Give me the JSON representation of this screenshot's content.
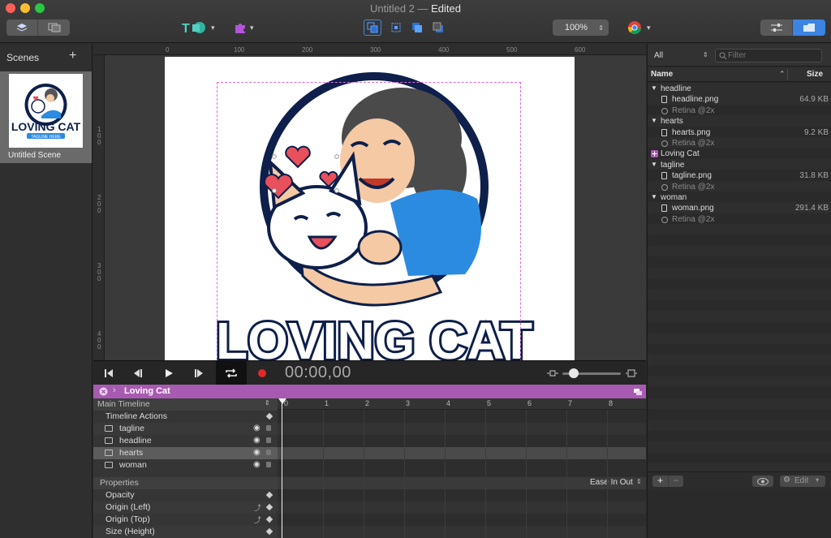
{
  "window": {
    "doc_title": "Untitled 2",
    "separator": "—",
    "status": "Edited"
  },
  "toolbar": {
    "zoom": "100%"
  },
  "scenes": {
    "title": "Scenes",
    "add": "+",
    "items": [
      {
        "label": "Untitled Scene"
      }
    ]
  },
  "ruler": {
    "top": [
      "0",
      "100",
      "200",
      "300",
      "400",
      "500",
      "600"
    ],
    "left": [
      "100",
      "200",
      "300",
      "400"
    ]
  },
  "logo": {
    "headline": "LOVING CAT",
    "thumb_headline": "LOVING CAT",
    "thumb_tagline": "TAGLINE HERE"
  },
  "transport": {
    "timecode": "00:00,00"
  },
  "timeline": {
    "name": "Loving Cat",
    "main_label": "Main Timeline",
    "actions_label": "Timeline Actions",
    "layers": [
      "tagline",
      "headline",
      "hearts",
      "woman"
    ],
    "selected_layer": "hearts",
    "ticks": [
      "0",
      "1",
      "2",
      "3",
      "4",
      "5",
      "6",
      "7",
      "8"
    ],
    "properties_label": "Properties",
    "easing": "Ease In Out",
    "properties": [
      "Opacity",
      "Origin (Left)",
      "Origin (Top)",
      "Size (Height)"
    ]
  },
  "resources": {
    "filter_scope": "All",
    "filter_placeholder": "Filter",
    "col_name": "Name",
    "col_size": "Size",
    "rows": [
      {
        "kind": "folder",
        "name": "headline",
        "size": ""
      },
      {
        "kind": "file",
        "name": "headline.png",
        "size": "64.9 KB"
      },
      {
        "kind": "retina",
        "name": "Retina @2x",
        "size": ""
      },
      {
        "kind": "folder",
        "name": "hearts",
        "size": ""
      },
      {
        "kind": "file",
        "name": "hearts.png",
        "size": "9.2 KB"
      },
      {
        "kind": "retina",
        "name": "Retina @2x",
        "size": ""
      },
      {
        "kind": "symbol",
        "name": "Loving Cat",
        "size": ""
      },
      {
        "kind": "folder",
        "name": "tagline",
        "size": ""
      },
      {
        "kind": "file",
        "name": "tagline.png",
        "size": "31.8 KB"
      },
      {
        "kind": "retina",
        "name": "Retina @2x",
        "size": ""
      },
      {
        "kind": "folder",
        "name": "woman",
        "size": ""
      },
      {
        "kind": "file",
        "name": "woman.png",
        "size": "291.4 KB"
      },
      {
        "kind": "retina",
        "name": "Retina @2x",
        "size": ""
      }
    ],
    "edit_label": "Edit"
  },
  "colors": {
    "timeline_accent": "#a85ab2",
    "logo_navy": "#0d1f4a",
    "logo_blue": "#2b8be0",
    "heart_red": "#e8505b"
  }
}
